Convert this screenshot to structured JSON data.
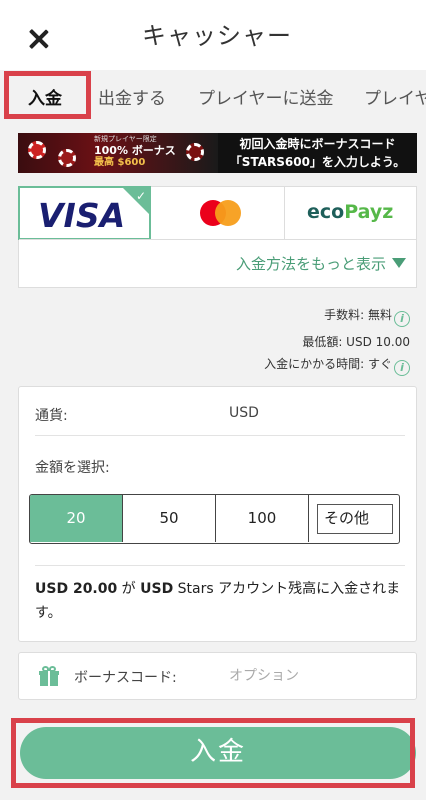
{
  "header": {
    "title": "キャッシャー"
  },
  "tabs": [
    {
      "label": "入金"
    },
    {
      "label": "出金する"
    },
    {
      "label": "プレイヤーに送金"
    },
    {
      "label": "プレイヤー"
    }
  ],
  "banner": {
    "badge_small": "新規プレイヤー限定",
    "badge_line1": "100% ボーナス",
    "badge_line2": "最高 $600",
    "right_line1": "初回入金時にボーナスコード",
    "right_line2": "「STARS600」を入力しよう。"
  },
  "payment_methods": {
    "visa": "VISA",
    "eco": "eco",
    "eco_suffix": "Payz",
    "more_label": "入金方法をもっと表示"
  },
  "info": {
    "fee": "手数料: 無料",
    "minimum": "最低額: USD 10.00",
    "time": "入金にかかる時間: すぐ"
  },
  "form": {
    "currency_label": "通貨:",
    "currency_value": "USD",
    "amount_label": "金額を選択:",
    "amounts": [
      "20",
      "50",
      "100"
    ],
    "other_placeholder": "その他",
    "summary_amount": "USD 20.00",
    "summary_mid": " が ",
    "summary_currency": "USD",
    "summary_rest": " Stars アカウント残高に入金されます。"
  },
  "bonus": {
    "label": "ボーナスコード:",
    "placeholder": "オプション"
  },
  "deposit_button": "入金",
  "colors": {
    "accent": "#6bbd98",
    "highlight": "#d9414a"
  }
}
